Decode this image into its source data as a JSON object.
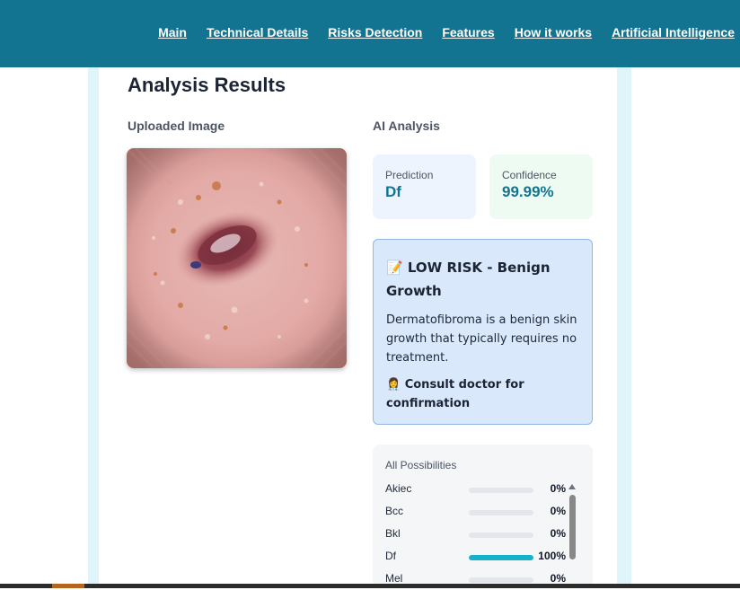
{
  "nav": {
    "links": [
      "Main",
      "Technical Details",
      "Risks Detection",
      "Features",
      "How it works",
      "Artificial Intelligence"
    ]
  },
  "results": {
    "title": "Analysis Results",
    "uploaded_label": "Uploaded Image",
    "ai_label": "AI Analysis"
  },
  "prediction": {
    "label": "Prediction",
    "value": "Df"
  },
  "confidence": {
    "label": "Confidence",
    "value": "99.99%"
  },
  "risk": {
    "title": "📝 LOW RISK - Benign Growth",
    "description": "Dermatofibroma is a benign skin growth that typically requires no treatment.",
    "consult": "👩‍⚕️ Consult doctor for confirmation"
  },
  "possibilities": {
    "title": "All Possibilities",
    "items": [
      {
        "name": "Akiec",
        "pct": "0%",
        "value": 0
      },
      {
        "name": "Bcc",
        "pct": "0%",
        "value": 0
      },
      {
        "name": "Bkl",
        "pct": "0%",
        "value": 0
      },
      {
        "name": "Df",
        "pct": "100%",
        "value": 100
      },
      {
        "name": "Mel",
        "pct": "0%",
        "value": 0
      }
    ]
  },
  "colors": {
    "header": "#127490",
    "accent": "#17b0c9",
    "prediction_bg": "#eef4fd",
    "confidence_bg": "#edfbf3",
    "risk_bg": "#d9e8fb"
  }
}
